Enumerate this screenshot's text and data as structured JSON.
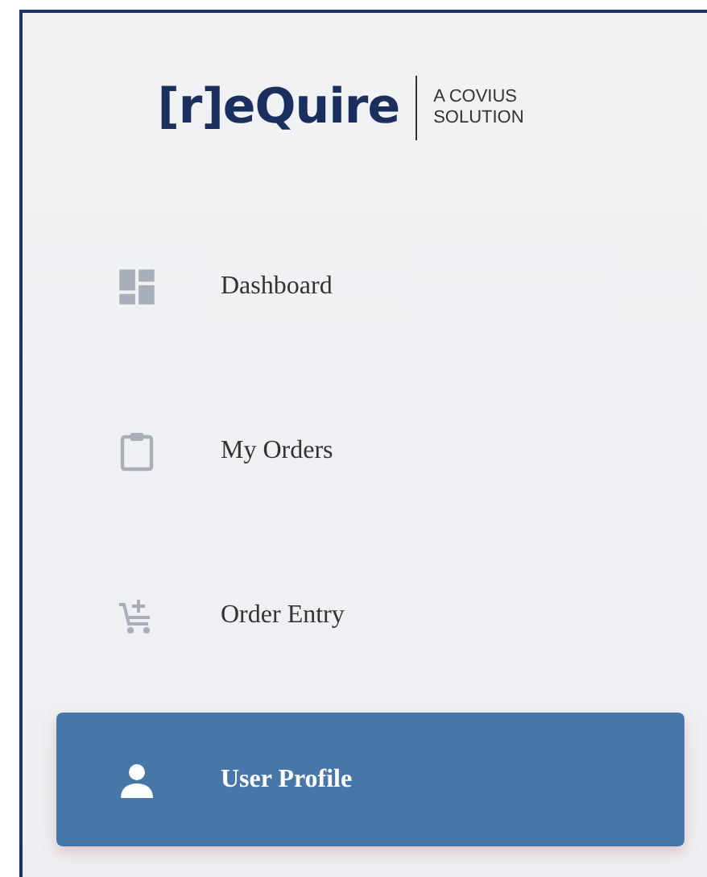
{
  "logo": {
    "wordmark": "[r]eQuire",
    "tagline": [
      "A COVIUS",
      "SOLUTION"
    ]
  },
  "nav_items": [
    {
      "label": "Dashboard",
      "kind": "dashboard",
      "selected": false
    },
    {
      "label": "My Orders",
      "kind": "orders",
      "selected": false
    },
    {
      "label": "Order Entry",
      "kind": "cart",
      "selected": false
    },
    {
      "label": "User Profile",
      "kind": "user",
      "selected": true
    }
  ]
}
